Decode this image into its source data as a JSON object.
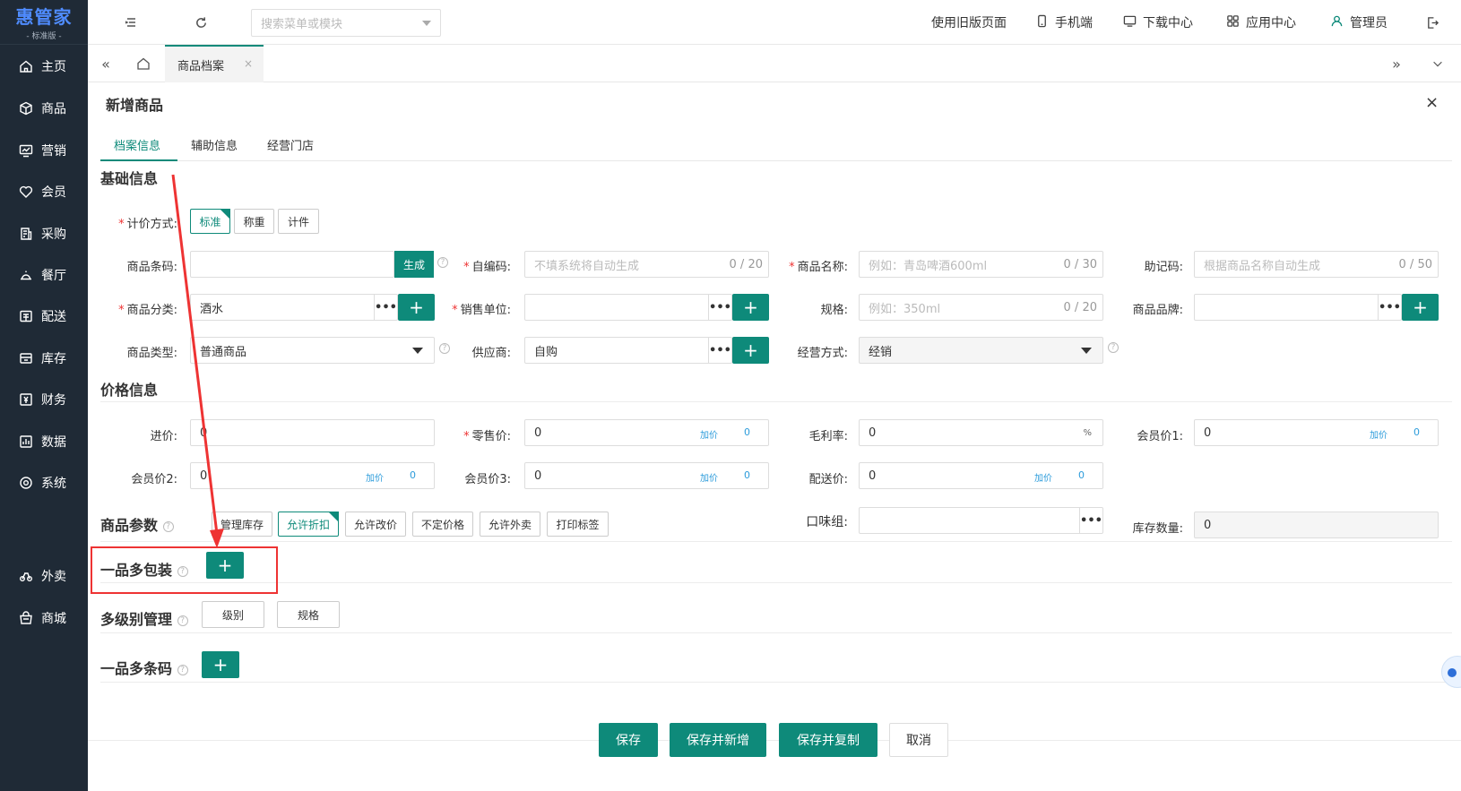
{
  "app": {
    "logo": "惠管家",
    "edition": "- 标准版 -"
  },
  "sidebar": {
    "items": [
      {
        "label": "主页",
        "icon": "home-icon"
      },
      {
        "label": "商品",
        "icon": "box-icon"
      },
      {
        "label": "营销",
        "icon": "chart-board-icon"
      },
      {
        "label": "会员",
        "icon": "heart-icon"
      },
      {
        "label": "采购",
        "icon": "purchase-list-icon"
      },
      {
        "label": "餐厅",
        "icon": "restaurant-icon"
      },
      {
        "label": "配送",
        "icon": "delivery-icon"
      },
      {
        "label": "库存",
        "icon": "warehouse-icon"
      },
      {
        "label": "财务",
        "icon": "finance-icon"
      },
      {
        "label": "数据",
        "icon": "data-icon"
      },
      {
        "label": "系统",
        "icon": "settings-icon"
      },
      {
        "label": "外卖",
        "icon": "takeout-icon"
      },
      {
        "label": "商城",
        "icon": "mall-icon"
      }
    ]
  },
  "topbar": {
    "search_placeholder": "搜索菜单或模块",
    "links": {
      "old_version": "使用旧版页面",
      "mobile": "手机端",
      "download": "下载中心",
      "apps": "应用中心",
      "user": "管理员"
    }
  },
  "tabs": {
    "current": "商品档案",
    "close": "×"
  },
  "panel": {
    "title": "新增商品",
    "close": "×",
    "subtabs": [
      "档案信息",
      "辅助信息",
      "经营门店"
    ]
  },
  "basic": {
    "title": "基础信息",
    "pricing_method": {
      "label": "计价方式:",
      "options": [
        "标准",
        "称重",
        "计件"
      ]
    },
    "barcode": {
      "label": "商品条码:",
      "value": "",
      "generate": "生成"
    },
    "code": {
      "label": "自编码:",
      "placeholder": "不填系统将自动生成",
      "count": "0 / 20"
    },
    "name": {
      "label": "商品名称:",
      "placeholder": "例如：青岛啤酒600ml",
      "count": "0 / 30"
    },
    "mnemonic": {
      "label": "助记码:",
      "placeholder": "根据商品名称自动生成",
      "count": "0 / 50"
    },
    "category": {
      "label": "商品分类:",
      "value": "酒水"
    },
    "unit": {
      "label": "销售单位:",
      "value": ""
    },
    "spec": {
      "label": "规格:",
      "placeholder": "例如：350ml",
      "count": "0 / 20"
    },
    "brand": {
      "label": "商品品牌:",
      "value": ""
    },
    "type": {
      "label": "商品类型:",
      "value": "普通商品"
    },
    "supplier": {
      "label": "供应商:",
      "value": "自购"
    },
    "mode": {
      "label": "经营方式:",
      "value": "经销"
    }
  },
  "price": {
    "title": "价格信息",
    "purchase": {
      "label": "进价:",
      "value": "0"
    },
    "retail": {
      "label": "零售价:",
      "value": "0",
      "add_label": "加价",
      "add_value": "0"
    },
    "margin": {
      "label": "毛利率:",
      "value": "0",
      "unit": "%"
    },
    "member1": {
      "label": "会员价1:",
      "value": "0",
      "add_label": "加价",
      "add_value": "0"
    },
    "member2": {
      "label": "会员价2:",
      "value": "0",
      "add_label": "加价",
      "add_value": "0"
    },
    "member3": {
      "label": "会员价3:",
      "value": "0",
      "add_label": "加价",
      "add_value": "0"
    },
    "delivery": {
      "label": "配送价:",
      "value": "0",
      "add_label": "加价",
      "add_value": "0"
    }
  },
  "params": {
    "title": "商品参数",
    "options": [
      "管理库存",
      "允许折扣",
      "允许改价",
      "不定价格",
      "允许外卖",
      "打印标签"
    ],
    "flavor": {
      "label": "口味组:",
      "value": ""
    },
    "stock": {
      "label": "库存数量:",
      "value": "0"
    }
  },
  "multi_package": {
    "title": "一品多包装"
  },
  "multi_level": {
    "title": "多级别管理",
    "options": [
      "级别",
      "规格"
    ]
  },
  "multi_barcode": {
    "title": "一品多条码"
  },
  "actions": {
    "save": "保存",
    "save_new": "保存并新增",
    "save_copy": "保存并复制",
    "cancel": "取消"
  },
  "symbols": {
    "plus": "+",
    "dots": "•••",
    "help": "?",
    "req": "*",
    "collapse": "«",
    "expand": "»"
  },
  "colors": {
    "primary": "#0e8a7a",
    "sidebar": "#1f2a36",
    "highlight": "#e33333"
  }
}
